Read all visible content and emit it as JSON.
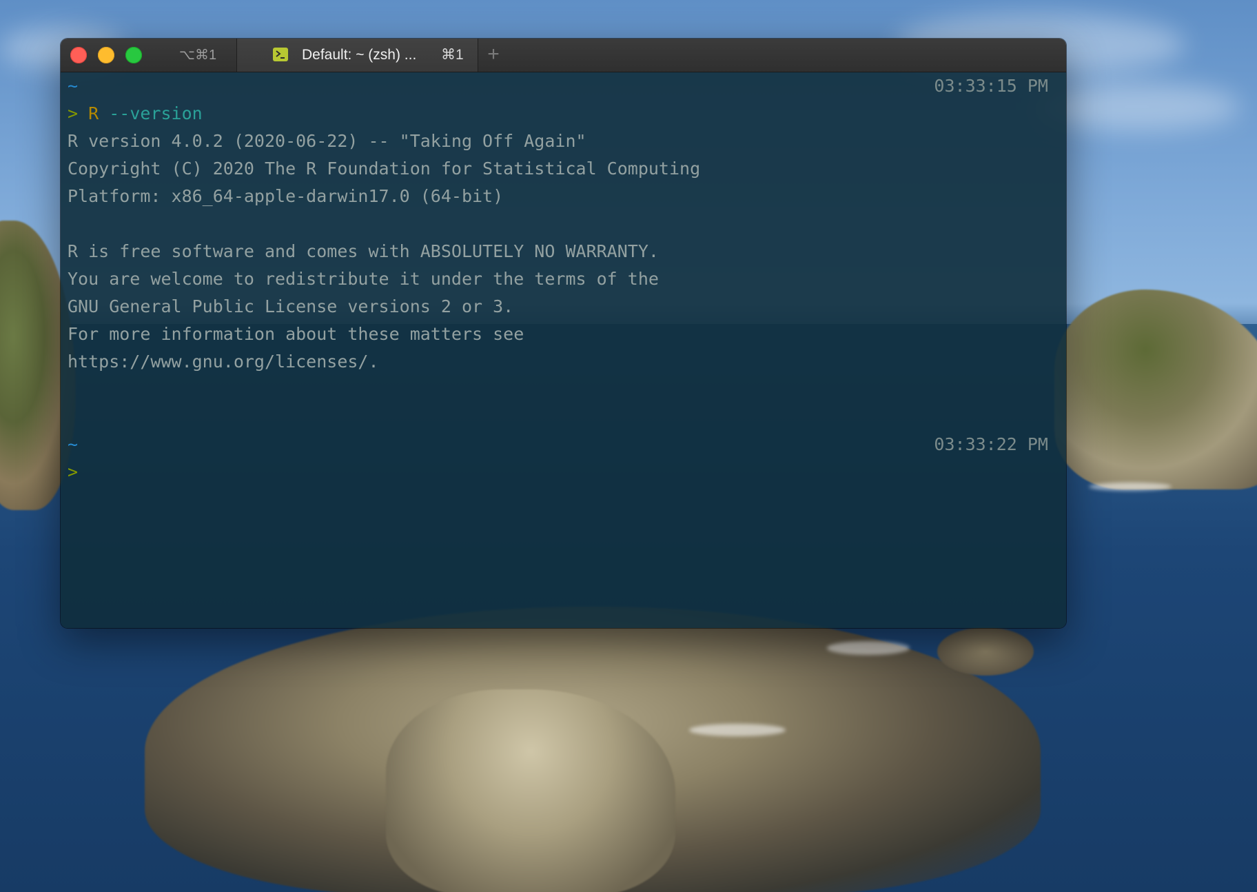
{
  "terminal": {
    "window_shortcut": "⌥⌘1",
    "tab": {
      "title": "Default: ~ (zsh) ...",
      "shortcut": "⌘1"
    },
    "new_tab_symbol": "+",
    "blocks": [
      {
        "cwd": "~",
        "timestamp": "03:33:15 PM",
        "prompt": ">",
        "command_name": "R",
        "command_args": "--version",
        "output": [
          "R version 4.0.2 (2020-06-22) -- \"Taking Off Again\"",
          "Copyright (C) 2020 The R Foundation for Statistical Computing",
          "Platform: x86_64-apple-darwin17.0 (64-bit)",
          "",
          "R is free software and comes with ABSOLUTELY NO WARRANTY.",
          "You are welcome to redistribute it under the terms of the",
          "GNU General Public License versions 2 or 3.",
          "For more information about these matters see",
          "https://www.gnu.org/licenses/."
        ]
      },
      {
        "cwd": "~",
        "timestamp": "03:33:22 PM",
        "prompt": ">"
      }
    ],
    "colors": {
      "cwd": "#268bd2",
      "prompt": "#859900",
      "command": "#2aa198",
      "output": "#93a1a1",
      "background": "#102e3c"
    }
  }
}
